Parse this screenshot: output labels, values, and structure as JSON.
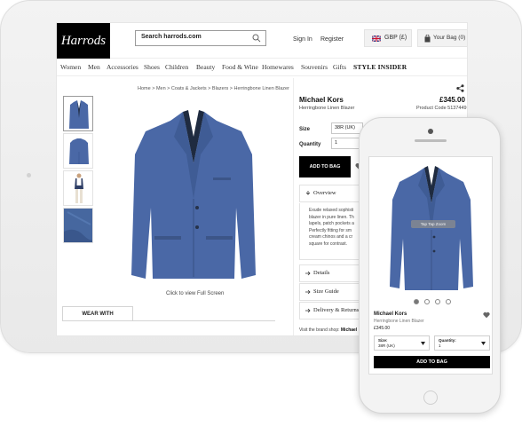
{
  "header": {
    "logo": "Harrods",
    "search_placeholder": "Search harrods.com",
    "sign_in": "Sign In",
    "register": "Register",
    "currency": "GBP (£)",
    "bag": "Your Bag (0)"
  },
  "nav": {
    "items": [
      "Women",
      "Men",
      "Accessories",
      "Shoes",
      "Children",
      "Beauty",
      "Food & Wine",
      "Homewares",
      "Souvenirs",
      "Gifts",
      "STYLE INSIDER"
    ]
  },
  "breadcrumb": "Home > Men > Coats & Jackets > Blazers > Herringbone Linen Blazer",
  "gallery": {
    "full_screen": "Click to view Full Screen",
    "wear_with": "WEAR WITH"
  },
  "product": {
    "brand": "Michael Kors",
    "price": "£345.00",
    "name": "Herringbone Linen Blazer",
    "code": "Product Code 5137449",
    "size_label": "Size",
    "size_value": "38R (UK)",
    "quantity_label": "Quantity",
    "quantity_value": "1",
    "add_to_bag": "ADD TO BAG",
    "accordion": {
      "overview": "Overview",
      "details": "Details",
      "size_guide": "Size Guide",
      "delivery": "Delivery & Returns"
    },
    "overview_lines": [
      "Exude relaxed sophisti",
      "blazer in pure linen. Th",
      "lapels, patch pockets a",
      "Perfectly fitting for sm",
      "cream chinos and a cr",
      "square for contrast."
    ],
    "visit_prefix": "Visit the brand shop: ",
    "visit_brand": "Michael"
  },
  "mobile": {
    "overlay": "Tap Tap Zoom",
    "brand": "Michael Kors",
    "name": "Herringbone Linen Blazer",
    "price": "£345.00",
    "size_label": "Size:",
    "size_value": "38R (UK)",
    "quantity_label": "Quantity:",
    "quantity_value": "1",
    "add_to_bag": "ADD TO BAG"
  },
  "colors": {
    "blazer": "#4a68a6",
    "accent": "#000000"
  }
}
